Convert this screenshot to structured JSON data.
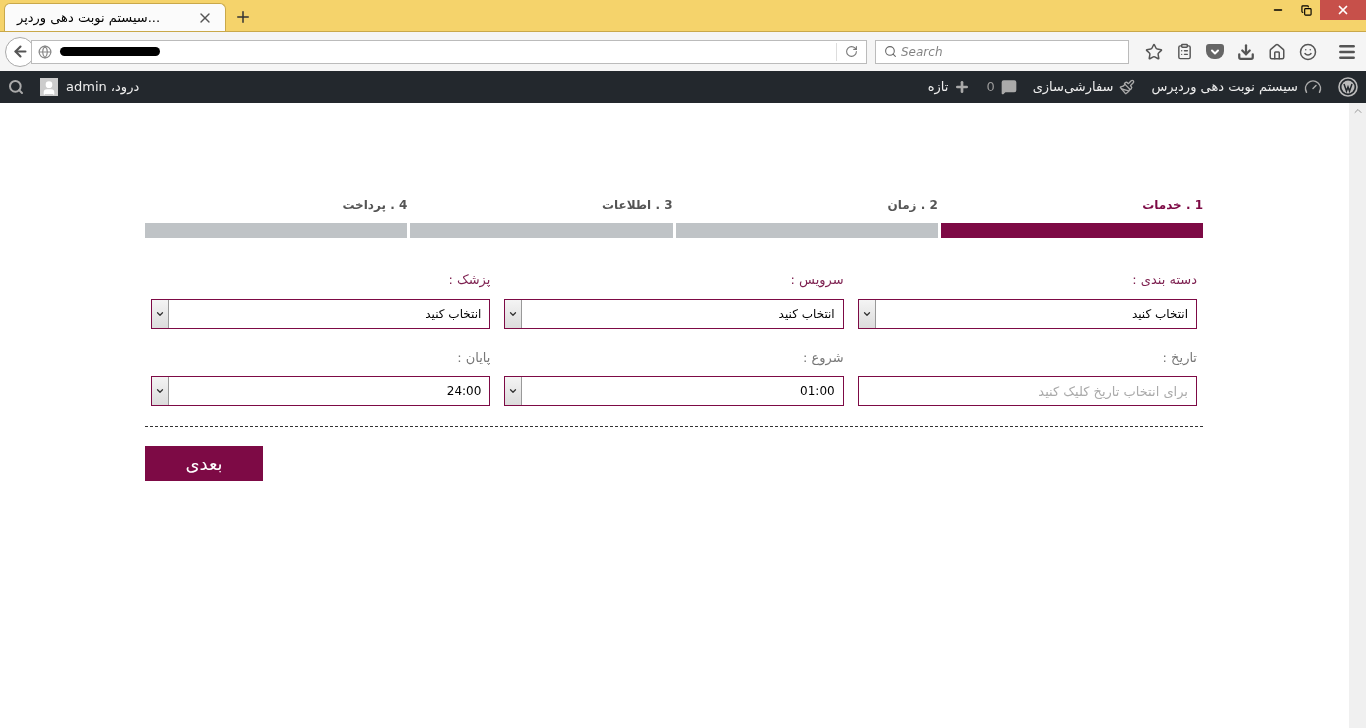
{
  "browser": {
    "tab_title": "...سیستم نوبت دهی وردپر",
    "search": {
      "placeholder": "Search"
    }
  },
  "admin_bar": {
    "site": "سیستم نوبت دهی وردپرس",
    "customize": "سفارشی‌سازی",
    "comments": "0",
    "new": "تازه",
    "greeting": "درود، admin"
  },
  "steps": [
    {
      "label": "1 . خدمات",
      "selected": true
    },
    {
      "label": "2 . زمان",
      "selected": false
    },
    {
      "label": "3 . اطلاعات",
      "selected": false
    },
    {
      "label": "4 . پرداخت",
      "selected": false
    }
  ],
  "fields": [
    {
      "label": "دسته بندی :",
      "kind": "select",
      "value": "انتخاب کنید",
      "emphasized": true
    },
    {
      "label": "سرویس :",
      "kind": "select",
      "value": "انتخاب کنید",
      "emphasized": true
    },
    {
      "label": "پزشک :",
      "kind": "select",
      "value": "انتخاب کنید",
      "emphasized": true
    },
    {
      "label": "تاریخ :",
      "kind": "date",
      "placeholder": "برای انتخاب تاریخ کلیک کنید",
      "emphasized": false
    },
    {
      "label": "شروع :",
      "kind": "select",
      "value": "01:00",
      "emphasized": false
    },
    {
      "label": "پایان :",
      "kind": "select",
      "value": "24:00",
      "emphasized": false
    }
  ],
  "next_button": "بعدی"
}
